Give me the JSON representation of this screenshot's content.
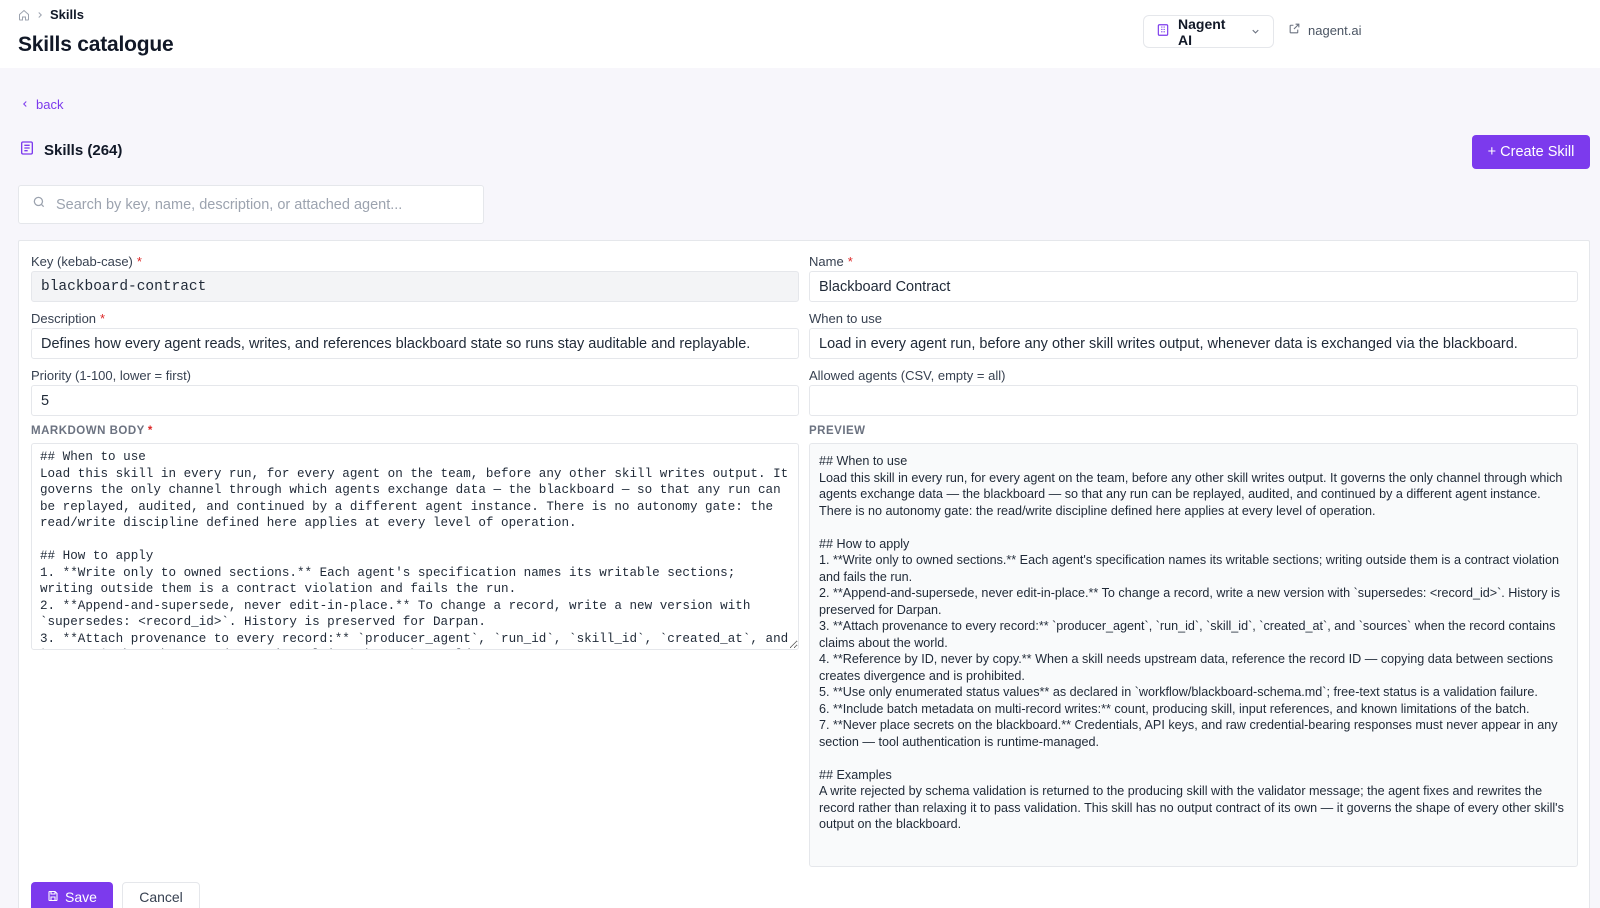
{
  "breadcrumb": {
    "home_icon": "home-icon",
    "current": "Skills"
  },
  "page": {
    "title": "Skills catalogue"
  },
  "org_switcher": {
    "label": "Nagent AI",
    "icon": "building-icon"
  },
  "external_link": {
    "label": "nagent.ai",
    "icon": "external-link-icon"
  },
  "back_link": {
    "label": "back"
  },
  "skills_header": {
    "label": "Skills (264)",
    "icon": "book-icon"
  },
  "create_button": {
    "label": "+ Create Skill"
  },
  "search": {
    "placeholder": "Search by key, name, description, or attached agent...",
    "value": ""
  },
  "form": {
    "key": {
      "label": "Key (kebab-case)",
      "required_mark": "*",
      "value": "blackboard-contract"
    },
    "name": {
      "label": "Name",
      "required_mark": "*",
      "value": "Blackboard Contract"
    },
    "description": {
      "label": "Description",
      "required_mark": "*",
      "value": "Defines how every agent reads, writes, and references blackboard state so runs stay auditable and replayable."
    },
    "when_to_use": {
      "label": "When to use",
      "value": "Load in every agent run, before any other skill writes output, whenever data is exchanged via the blackboard."
    },
    "priority": {
      "label": "Priority (1-100, lower = first)",
      "value": "5"
    },
    "allowed_agents": {
      "label": "Allowed agents (CSV, empty = all)",
      "value": ""
    },
    "markdown_label": "MARKDOWN BODY",
    "markdown_required_mark": "*",
    "markdown_body": "## When to use\nLoad this skill in every run, for every agent on the team, before any other skill writes output. It governs the only channel through which agents exchange data — the blackboard — so that any run can be replayed, audited, and continued by a different agent instance. There is no autonomy gate: the read/write discipline defined here applies at every level of operation.\n\n## How to apply\n1. **Write only to owned sections.** Each agent's specification names its writable sections; writing outside them is a contract violation and fails the run.\n2. **Append-and-supersede, never edit-in-place.** To change a record, write a new version with `supersedes: <record_id>`. History is preserved for Darpan.\n3. **Attach provenance to every record:** `producer_agent`, `run_id`, `skill_id`, `created_at`, and `sources` when the record contains claims about the world.",
    "preview_label": "PREVIEW",
    "preview_body": "## When to use\nLoad this skill in every run, for every agent on the team, before any other skill writes output. It governs the only channel through which agents exchange data — the blackboard — so that any run can be replayed, audited, and continued by a different agent instance. There is no autonomy gate: the read/write discipline defined here applies at every level of operation.\n\n## How to apply\n1. **Write only to owned sections.** Each agent's specification names its writable sections; writing outside them is a contract violation and fails the run.\n2. **Append-and-supersede, never edit-in-place.** To change a record, write a new version with `supersedes: <record_id>`. History is preserved for Darpan.\n3. **Attach provenance to every record:** `producer_agent`, `run_id`, `skill_id`, `created_at`, and `sources` when the record contains claims about the world.\n4. **Reference by ID, never by copy.** When a skill needs upstream data, reference the record ID — copying data between sections creates divergence and is prohibited.\n5. **Use only enumerated status values** as declared in `workflow/blackboard-schema.md`; free-text status is a validation failure.\n6. **Include batch metadata on multi-record writes:** count, producing skill, input references, and known limitations of the batch.\n7. **Never place secrets on the blackboard.** Credentials, API keys, and raw credential-bearing responses must never appear in any section — tool authentication is runtime-managed.\n\n## Examples\nA write rejected by schema validation is returned to the producing skill with the validator message; the agent fixes and rewrites the record rather than relaxing it to pass validation. This skill has no output contract of its own — it governs the shape of every other skill's output on the blackboard.",
    "save_label": "Save",
    "cancel_label": "Cancel"
  },
  "colors": {
    "accent": "#7c3aed",
    "required": "#dc2626",
    "content_bg": "#f7f6fb"
  }
}
